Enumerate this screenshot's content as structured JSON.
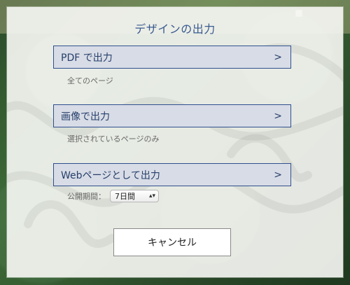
{
  "modal": {
    "title": "デザインの出力",
    "options": [
      {
        "label": "PDF で出力",
        "arrow": ">",
        "subtext": "全てのページ"
      },
      {
        "label": "画像で出力",
        "arrow": ">",
        "subtext": "選択されているページのみ"
      },
      {
        "label": "Webページとして出力",
        "arrow": ">"
      }
    ],
    "publish_period": {
      "label": "公開期間：",
      "selected_value": "7日間"
    },
    "cancel_label": "キャンセル"
  },
  "icons": {
    "select_chevron": "up-down-chevron-icon",
    "option_arrow": "chevron-right-icon"
  },
  "colors": {
    "accent_blue": "#2f4f8e",
    "option_bg": "#d8dce6",
    "modal_bg": "#f5f6f2"
  }
}
